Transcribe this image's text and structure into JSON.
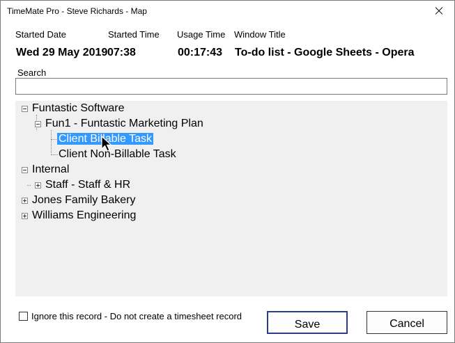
{
  "window": {
    "title": "TimeMate Pro - Steve Richards - Map"
  },
  "headers": {
    "started_date": "Started Date",
    "started_time": "Started Time",
    "usage_time": "Usage Time",
    "window_title": "Window Title"
  },
  "values": {
    "started_date": "Wed 29 May 2019",
    "started_time": "07:38",
    "usage_time": "00:17:43",
    "window_title": "To-do list - Google Sheets - Opera"
  },
  "search": {
    "label": "Search",
    "value": "",
    "placeholder": ""
  },
  "tree": {
    "nodes": [
      {
        "label": "Funtastic Software",
        "state": "expanded"
      },
      {
        "label": "Fun1 - Funtastic Marketing Plan",
        "state": "expanded"
      },
      {
        "label": "Client Billable Task",
        "state": "selected"
      },
      {
        "label": "Client Non-Billable Task",
        "state": "leaf"
      },
      {
        "label": "Internal",
        "state": "expanded"
      },
      {
        "label": "Staff - Staff & HR",
        "state": "collapsed"
      },
      {
        "label": "Jones Family Bakery",
        "state": "collapsed"
      },
      {
        "label": "Williams Engineering",
        "state": "collapsed"
      }
    ]
  },
  "ignore_checkbox": {
    "label": "Ignore this record - Do not create a timesheet record",
    "checked": false
  },
  "buttons": {
    "save": "Save",
    "cancel": "Cancel"
  },
  "colors": {
    "selection": "#3399ff",
    "tree_bg": "#f0f0f0",
    "save_border": "#2b3b8f"
  }
}
